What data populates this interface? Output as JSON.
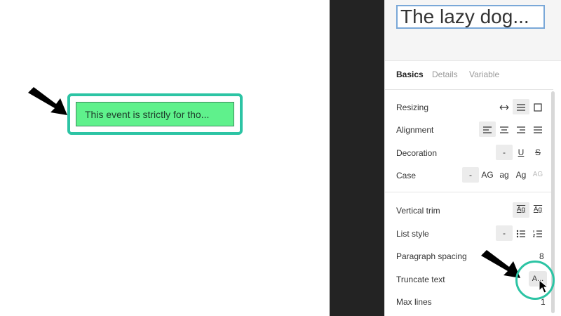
{
  "canvas": {
    "text_layer": "This event is strictly for tho...",
    "frame_color": "#2cc4a4",
    "fill_color": "#5ff18c"
  },
  "panel": {
    "preview_text": "The lazy dog...",
    "tabs": [
      {
        "label": "Basics",
        "active": true
      },
      {
        "label": "Details",
        "active": false
      },
      {
        "label": "Variable",
        "active": false
      }
    ],
    "rows": {
      "resizing": {
        "label": "Resizing"
      },
      "alignment": {
        "label": "Alignment"
      },
      "decoration": {
        "label": "Decoration",
        "none": "-",
        "underline": "U",
        "strike": "S"
      },
      "case": {
        "label": "Case",
        "none": "-",
        "upper": "AG",
        "lower": "ag",
        "title": "Ag",
        "smallcaps": "AG"
      },
      "vertical_trim": {
        "label": "Vertical trim",
        "a": "Ag",
        "b": "Ag"
      },
      "list_style": {
        "label": "List style",
        "none": "-"
      },
      "paragraph_spacing": {
        "label": "Paragraph spacing",
        "value": "8"
      },
      "truncate_text": {
        "label": "Truncate text",
        "button": "A..."
      },
      "max_lines": {
        "label": "Max lines",
        "value": "1"
      }
    }
  }
}
